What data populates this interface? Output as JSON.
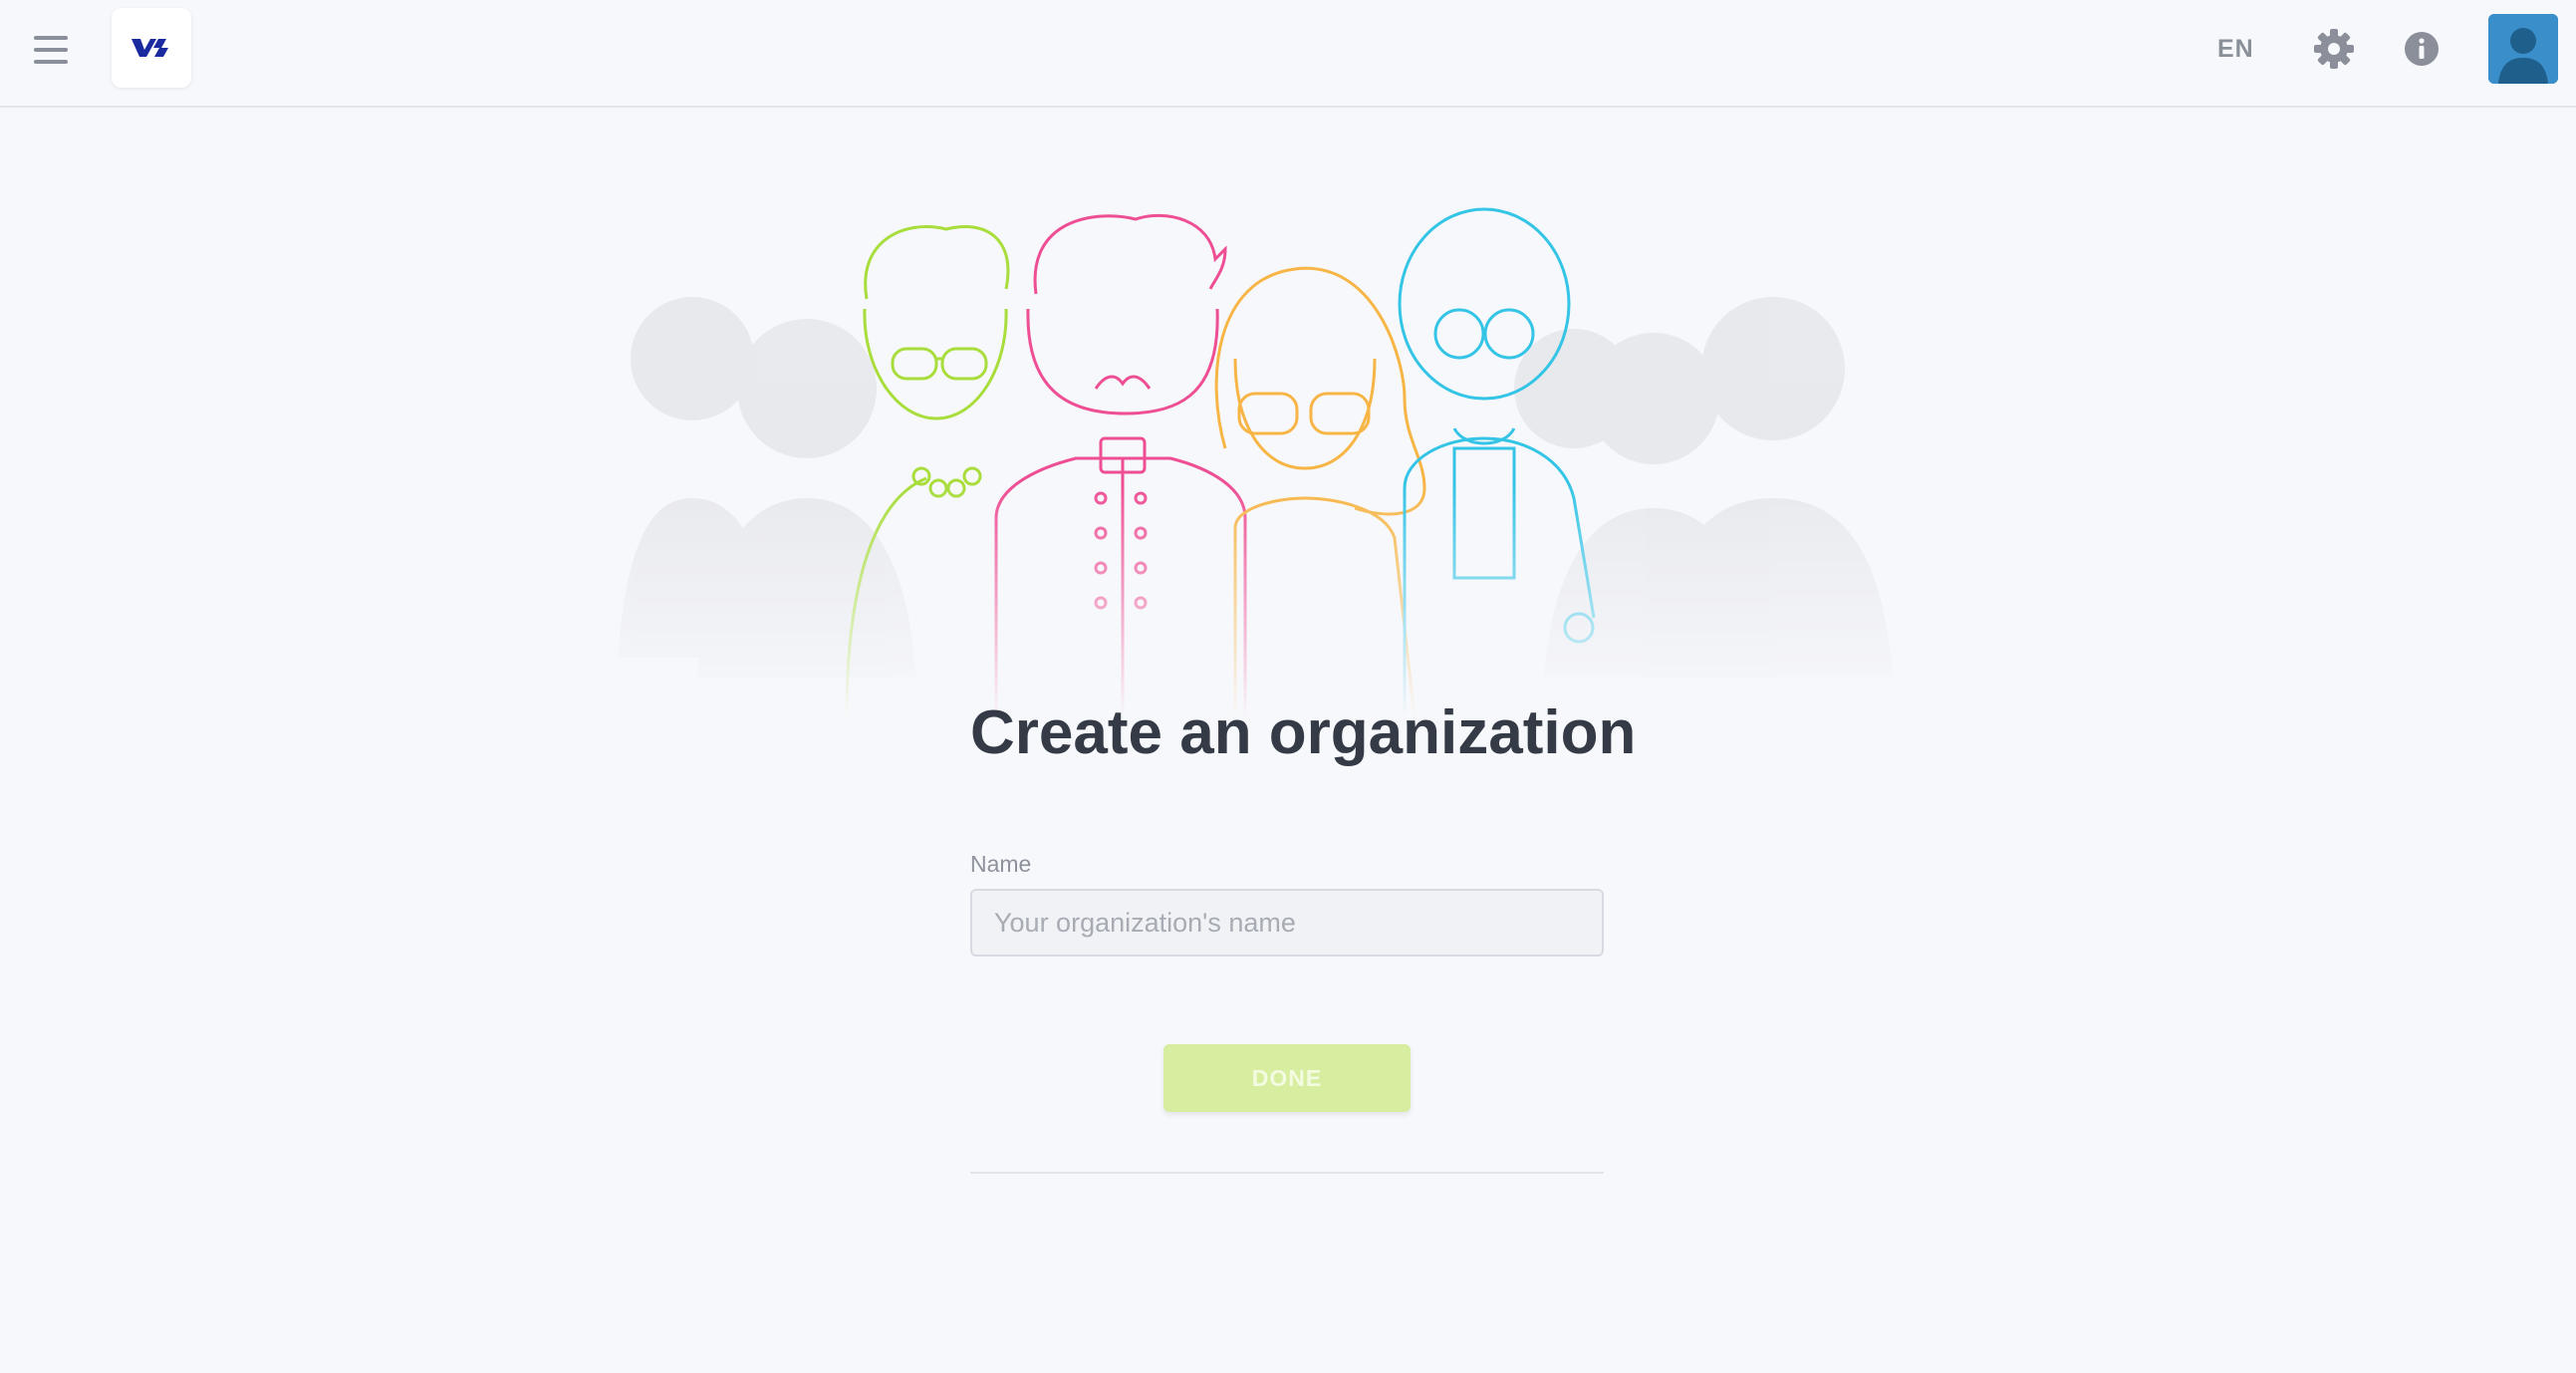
{
  "header": {
    "language": "EN",
    "icons": {
      "menu": "hamburger-menu-icon",
      "logo": "app-logo",
      "settings": "gear-icon",
      "info": "info-icon",
      "avatar": "user-avatar"
    }
  },
  "main": {
    "title": "Create an organization",
    "name_label": "Name",
    "name_placeholder": "Your organization's name",
    "name_value": "",
    "done_label": "DONE"
  },
  "colors": {
    "background": "#f7f8fb",
    "accent_green": "#d7eea0",
    "logo_blue": "#1b2a9e",
    "person_green": "#a8dd3c",
    "person_pink": "#ee4f94",
    "person_orange": "#f7b546",
    "person_blue": "#34c4e6"
  }
}
